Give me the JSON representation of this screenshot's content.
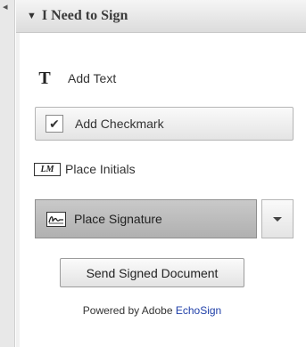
{
  "gutter": {
    "arrow": "◂"
  },
  "panel": {
    "title": "I Need to Sign",
    "caret": "▼"
  },
  "actions": {
    "add_text": {
      "icon_glyph": "T",
      "label": "Add Text"
    },
    "add_checkmark": {
      "icon_glyph": "✔",
      "label": "Add Checkmark"
    },
    "place_initials": {
      "icon_glyph": "LM",
      "label": "Place Initials"
    },
    "place_signature": {
      "label": "Place Signature"
    },
    "send": {
      "label": "Send Signed Document"
    }
  },
  "footer": {
    "prefix": "Powered by Adobe",
    "link": "EchoSign"
  }
}
